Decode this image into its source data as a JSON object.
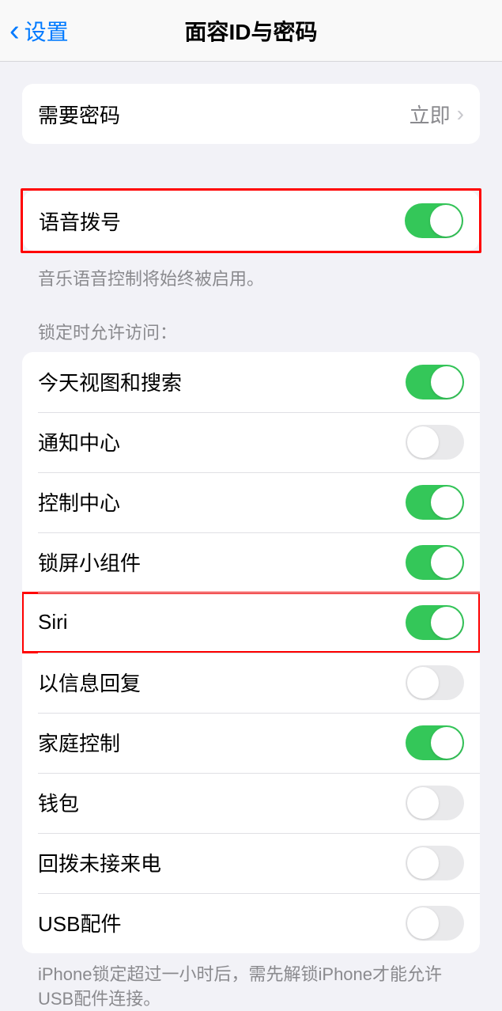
{
  "navbar": {
    "back_label": "设置",
    "title": "面容ID与密码"
  },
  "require_passcode": {
    "label": "需要密码",
    "value": "立即"
  },
  "voice_dial": {
    "label": "语音拨号",
    "footer": "音乐语音控制将始终被启用。",
    "on": true
  },
  "lock_access": {
    "header": "锁定时允许访问：",
    "items": [
      {
        "label": "今天视图和搜索",
        "on": true
      },
      {
        "label": "通知中心",
        "on": false
      },
      {
        "label": "控制中心",
        "on": true
      },
      {
        "label": "锁屏小组件",
        "on": true
      },
      {
        "label": "Siri",
        "on": true,
        "highlight": true
      },
      {
        "label": "以信息回复",
        "on": false
      },
      {
        "label": "家庭控制",
        "on": true
      },
      {
        "label": "钱包",
        "on": false
      },
      {
        "label": "回拨未接来电",
        "on": false
      },
      {
        "label": "USB配件",
        "on": false
      }
    ],
    "footer": "iPhone锁定超过一小时后，需先解锁iPhone才能允许USB配件连接。"
  }
}
